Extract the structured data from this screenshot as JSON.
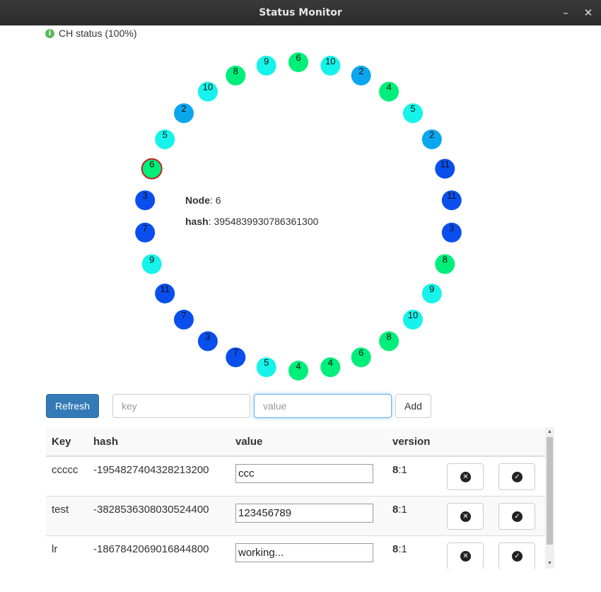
{
  "window": {
    "title": "Status Monitor",
    "minimize_glyph": "–",
    "close_glyph": "✕"
  },
  "status": {
    "icon": "info-icon",
    "text": "CH status (100%)"
  },
  "colors": {
    "green": "#00ee7a",
    "cyan": "#15f3ea",
    "sky": "#0aa6ee",
    "blue": "#0a4fee",
    "selected_stroke": "#c62020",
    "primary": "#337ab7"
  },
  "ring": {
    "nodes": [
      {
        "label": "6",
        "color": "green"
      },
      {
        "label": "10",
        "color": "cyan"
      },
      {
        "label": "2",
        "color": "sky"
      },
      {
        "label": "4",
        "color": "green"
      },
      {
        "label": "5",
        "color": "cyan"
      },
      {
        "label": "2",
        "color": "sky"
      },
      {
        "label": "11",
        "color": "blue"
      },
      {
        "label": "11",
        "color": "blue"
      },
      {
        "label": "3",
        "color": "blue"
      },
      {
        "label": "8",
        "color": "green"
      },
      {
        "label": "9",
        "color": "cyan"
      },
      {
        "label": "10",
        "color": "cyan"
      },
      {
        "label": "8",
        "color": "green"
      },
      {
        "label": "6",
        "color": "green"
      },
      {
        "label": "4",
        "color": "green"
      },
      {
        "label": "4",
        "color": "green"
      },
      {
        "label": "5",
        "color": "cyan"
      },
      {
        "label": "7",
        "color": "blue"
      },
      {
        "label": "3",
        "color": "blue"
      },
      {
        "label": "7",
        "color": "blue"
      },
      {
        "label": "11",
        "color": "blue"
      },
      {
        "label": "9",
        "color": "cyan"
      },
      {
        "label": "7",
        "color": "blue"
      },
      {
        "label": "3",
        "color": "blue"
      },
      {
        "label": "6",
        "color": "green",
        "selected": true
      },
      {
        "label": "5",
        "color": "cyan"
      },
      {
        "label": "2",
        "color": "sky"
      },
      {
        "label": "10",
        "color": "cyan"
      },
      {
        "label": "8",
        "color": "green"
      },
      {
        "label": "9",
        "color": "cyan"
      }
    ]
  },
  "node_info": {
    "node_label": "Node",
    "node_value": "6",
    "hash_label": "hash",
    "hash_value": "3954839930786361300"
  },
  "controls": {
    "refresh_label": "Refresh",
    "key_placeholder": "key",
    "value_placeholder": "value",
    "add_label": "Add"
  },
  "table": {
    "headers": {
      "key": "Key",
      "hash": "hash",
      "value": "value",
      "version": "version"
    },
    "rows": [
      {
        "key": "ccccc",
        "hash": "-1954827404328213200",
        "value": "ccc",
        "version_major": "8",
        "version_minor": ":1"
      },
      {
        "key": "test",
        "hash": "-3828536308030524400",
        "value": "123456789",
        "version_major": "8",
        "version_minor": ":1"
      },
      {
        "key": "lr",
        "hash": "-1867842069016844800",
        "value": "working...",
        "version_major": "8",
        "version_minor": ":1"
      }
    ],
    "delete_icon": "remove-circle-icon",
    "save_icon": "ok-circle-icon"
  }
}
